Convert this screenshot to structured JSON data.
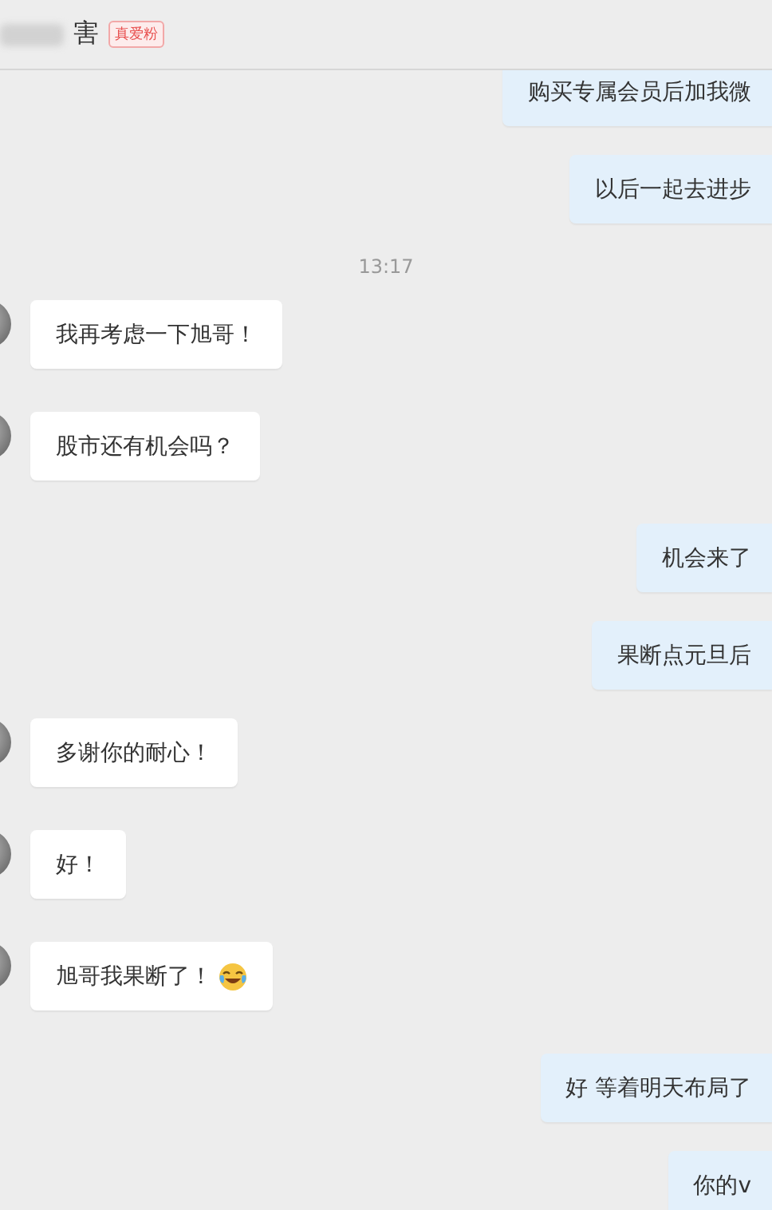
{
  "header": {
    "title": "害",
    "badge": "真爱粉"
  },
  "messages": [
    {
      "kind": "outgoing",
      "text": "购买专属会员后加我微"
    },
    {
      "kind": "outgoing",
      "text": "以后一起去进步"
    },
    {
      "kind": "time",
      "text": "13:17"
    },
    {
      "kind": "incoming",
      "text": "我再考虑一下旭哥！"
    },
    {
      "kind": "incoming",
      "text": "股市还有机会吗？"
    },
    {
      "kind": "outgoing",
      "text": "机会来了"
    },
    {
      "kind": "outgoing",
      "text": "果断点元旦后"
    },
    {
      "kind": "incoming",
      "text": "多谢你的耐心！"
    },
    {
      "kind": "incoming",
      "text": "好！"
    },
    {
      "kind": "incoming",
      "text": "旭哥我果断了！",
      "emoji": true
    },
    {
      "kind": "outgoing",
      "text": "好  等着明天布局了"
    },
    {
      "kind": "outgoing",
      "text": "你的v"
    }
  ]
}
